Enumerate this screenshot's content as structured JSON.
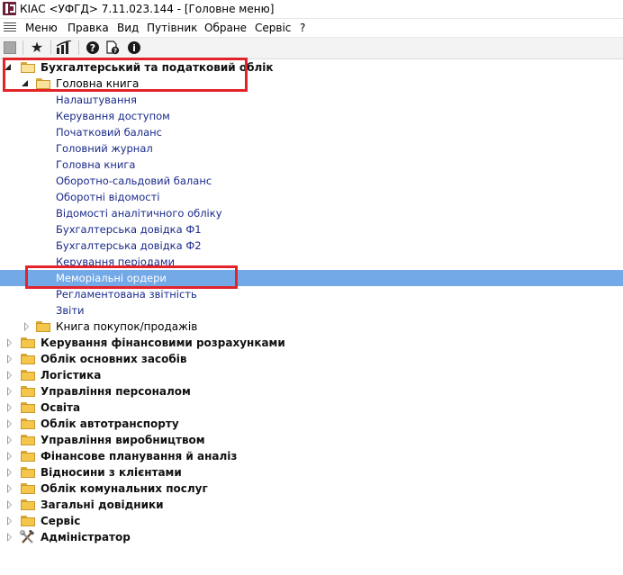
{
  "window": {
    "title": "КІАС <УФГД> 7.11.023.144 - [Головне меню]"
  },
  "menubar": {
    "items": [
      "Меню",
      "Правка",
      "Вид",
      "Путівник",
      "Обране",
      "Сервіс",
      "?"
    ]
  },
  "toolbar": {
    "buttons": [
      "window-icon",
      "star-icon",
      "chart-icon",
      "help-icon",
      "doc-help-icon",
      "info-icon"
    ]
  },
  "tree": {
    "root": {
      "label": "Бухгалтерський та податковий облік",
      "expanded": true
    },
    "ledger": {
      "label": "Головна книга",
      "expanded": true
    },
    "ledger_items": [
      "Налаштування",
      "Керування доступом",
      "Початковий баланс",
      "Головний журнал",
      "Головна книга",
      "Оборотно-сальдовий баланс",
      "Оборотні відомості",
      "Відомості аналітичного обліку",
      "Бухгалтерська довідка Ф1",
      "Бухгалтерська довідка Ф2",
      "Керування періодами",
      "Меморіальні ордери",
      "Регламентована звітність",
      "Звіти"
    ],
    "selected_item": "Меморіальні ордери",
    "purchases": {
      "label": "Книга покупок/продажів",
      "expanded": false
    },
    "modules": [
      "Керування фінансовими розрахунками",
      "Облік основних засобів",
      "Логістика",
      "Управління персоналом",
      "Освіта",
      "Облік автотранспорту",
      "Управління виробництвом",
      "Фінансове планування й аналіз",
      "Відносини з клієнтами",
      "Облік комунальних послуг",
      "Загальні довідники",
      "Сервіс"
    ],
    "admin": {
      "label": "Адміністратор"
    }
  },
  "colors": {
    "selection": "#73a9e6",
    "highlight": "#e3232a",
    "link": "#1a2a8a"
  }
}
